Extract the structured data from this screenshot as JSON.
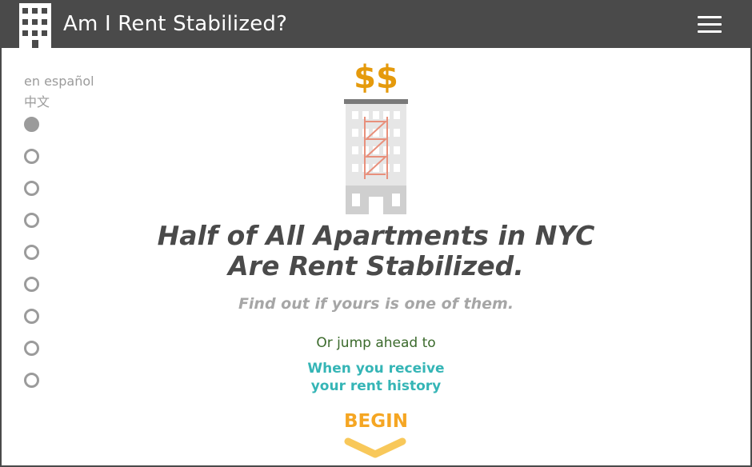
{
  "header": {
    "title": "Am I Rent Stabilized?",
    "logo_icon": "building-icon",
    "menu_icon": "hamburger-menu-icon"
  },
  "sidebar": {
    "languages": [
      "en español",
      "中文"
    ],
    "nav_steps": 9,
    "active_step": 1
  },
  "hero": {
    "illustration_icon": "apartment-building-with-dollar-signs-icon",
    "dollar_text": "$$"
  },
  "main": {
    "headline_line1": "Half of All Apartments in NYC",
    "headline_line2": "Are Rent Stabilized.",
    "subhead": "Find out if yours is one of them.",
    "jump_text": "Or jump ahead to",
    "jump_link_line1": "When you receive",
    "jump_link_line2": "your rent history",
    "begin_label": "BEGIN",
    "begin_icon": "chevron-down-icon"
  },
  "colors": {
    "header_bg": "#4a4a4a",
    "headline": "#4a4a4a",
    "subhead": "#a6a6a6",
    "jump_text": "#3b6a2c",
    "jump_link": "#35b5b6",
    "begin": "#f5a623",
    "chevron": "#f8c85a",
    "dollar": "#e59a0c"
  }
}
